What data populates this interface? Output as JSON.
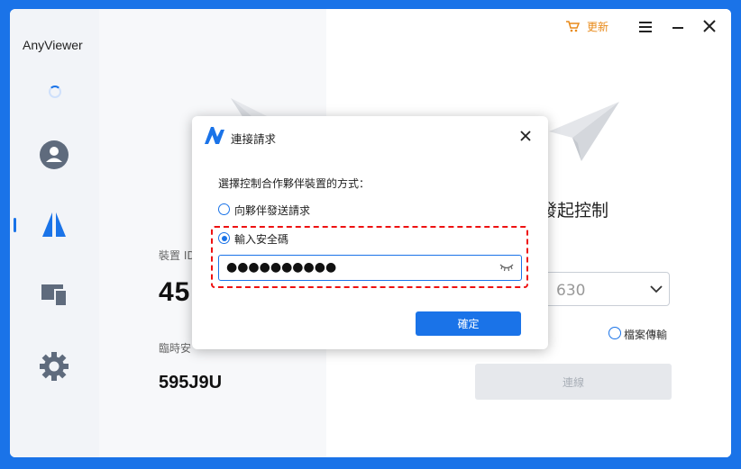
{
  "app": {
    "name": "AnyViewer"
  },
  "topbar": {
    "update_label": "更新"
  },
  "left_panel": {
    "device_label": "裝置 ID",
    "device_id": "45",
    "temp_label": "臨時安",
    "temp_code": "595J9U"
  },
  "right_panel": {
    "title": "發起控制",
    "partner_value": "630",
    "file_transfer_label": "檔案傳輸",
    "connect_label": "連線"
  },
  "dialog": {
    "title": "連接請求",
    "prompt": "選擇控制合作夥伴裝置的方式：",
    "options": [
      {
        "label": "向夥伴發送請求",
        "selected": false
      },
      {
        "label": "輸入安全碼",
        "selected": true
      }
    ],
    "password_value": "●●●●●●●●●●",
    "ok_label": "確定"
  },
  "colors": {
    "accent": "#1a73e8",
    "highlight": "#e11111",
    "update": "#e88a1a"
  }
}
